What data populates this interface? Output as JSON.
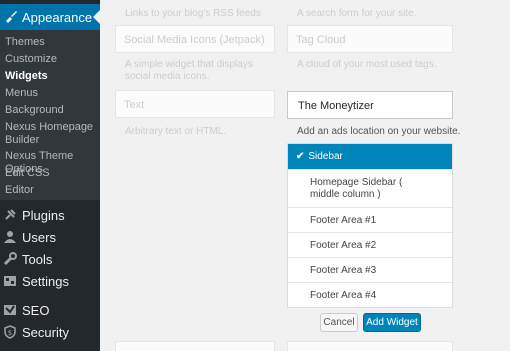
{
  "sidebar": {
    "appearance": {
      "label": "Appearance",
      "icon": "brush-icon"
    },
    "submenu": [
      {
        "label": "Themes"
      },
      {
        "label": "Customize"
      },
      {
        "label": "Widgets",
        "current": true
      },
      {
        "label": "Menus"
      },
      {
        "label": "Background"
      },
      {
        "label": "Nexus Homepage Builder"
      },
      {
        "label": "Nexus Theme Options"
      },
      {
        "label": "Edit CSS"
      },
      {
        "label": "Editor"
      }
    ],
    "menu": [
      {
        "label": "Plugins",
        "icon": "plugin-icon"
      },
      {
        "label": "Users",
        "icon": "users-icon"
      },
      {
        "label": "Tools",
        "icon": "wrench-icon"
      },
      {
        "label": "Settings",
        "icon": "settings-icon"
      },
      {
        "label": "SEO",
        "icon": "seo-icon"
      },
      {
        "label": "Security",
        "icon": "shield-icon"
      }
    ]
  },
  "widgets": {
    "rss_desc": "Links to your blog's RSS feeds",
    "search_desc": "A search form for your site.",
    "social": {
      "title": "Social Media Icons (Jetpack)",
      "desc": "A simple widget that displays social media icons."
    },
    "tagcloud": {
      "title": "Tag Cloud",
      "desc": "A cloud of your most used tags."
    },
    "text": {
      "title": "Text",
      "desc": "Arbitrary text or HTML."
    },
    "moneytizer": {
      "title": "The Moneytizer",
      "desc": "Add an ads location on your website."
    }
  },
  "sidebar_choices": [
    {
      "label": "Sidebar",
      "selected": true
    },
    {
      "label": "Homepage Sidebar ( middle column )"
    },
    {
      "label": "Footer Area #1"
    },
    {
      "label": "Footer Area #2"
    },
    {
      "label": "Footer Area #3"
    },
    {
      "label": "Footer Area #4"
    }
  ],
  "buttons": {
    "cancel": "Cancel",
    "add": "Add Widget"
  },
  "colors": {
    "accent": "#0073aa",
    "selected": "#0085ba",
    "sidebar_bg": "#23282d"
  }
}
